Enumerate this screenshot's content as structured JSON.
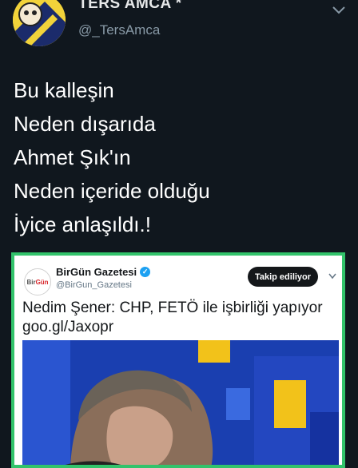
{
  "author": {
    "display_name": "TERS AMCA *",
    "handle": "@_TersAmca",
    "avatar_icon": "avatar-image"
  },
  "tweet": {
    "lines": [
      "Bu kalleşin",
      "Neden dışarıda",
      "Ahmet Şık'ın",
      "Neden içeride olduğu",
      "İyice anlaşıldı.!"
    ]
  },
  "quoted": {
    "account_name": "BirGün Gazetesi",
    "handle": "@BirGun_Gazetesi",
    "avatar_text_1": "Bir",
    "avatar_text_2": "Gün",
    "follow_label": "Takip ediliyor",
    "headline": "Nedim Şener: CHP, FETÖ ile işbirliği yapıyor",
    "link": "goo.gl/Jaxopr"
  },
  "colors": {
    "background": "#10171e",
    "embed_border": "#32c36b",
    "verified": "#1da1f2"
  }
}
